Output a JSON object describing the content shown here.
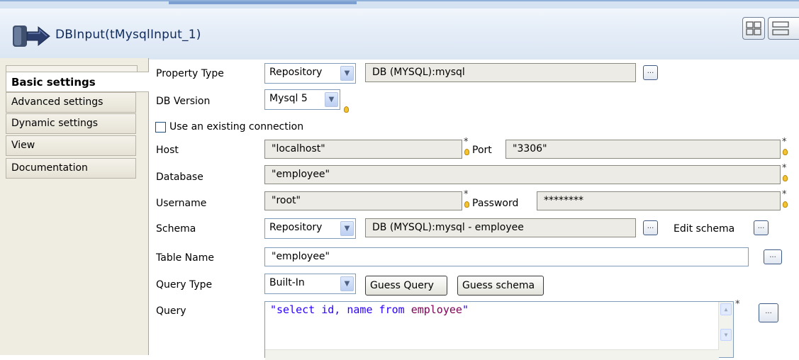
{
  "header": {
    "title": "DBInput(tMysqlInput_1)"
  },
  "icons": {
    "component": "component-arrow-icon",
    "layout_grid": "layout-grid-icon",
    "layout_rows": "layout-rows-icon"
  },
  "nav": {
    "items": [
      {
        "label": "Basic settings",
        "active": true
      },
      {
        "label": "Advanced settings"
      },
      {
        "label": "Dynamic settings"
      },
      {
        "label": "View"
      },
      {
        "label": "Documentation"
      }
    ]
  },
  "form": {
    "property_type": {
      "label": "Property Type",
      "value": "Repository",
      "repo_value": "DB (MYSQL):mysql"
    },
    "db_version": {
      "label": "DB Version",
      "value": "Mysql 5"
    },
    "use_existing_connection": {
      "label": "Use an existing connection",
      "checked": false
    },
    "host": {
      "label": "Host",
      "value": "\"localhost\""
    },
    "port": {
      "label": "Port",
      "value": "\"3306\""
    },
    "database": {
      "label": "Database",
      "value": "\"employee\""
    },
    "username": {
      "label": "Username",
      "value": "\"root\""
    },
    "password": {
      "label": "Password",
      "value": "********"
    },
    "schema": {
      "label": "Schema",
      "value": "Repository",
      "repo_value": "DB (MYSQL):mysql - employee",
      "edit_label": "Edit schema"
    },
    "table_name": {
      "label": "Table Name",
      "value": "\"employee\""
    },
    "query_type": {
      "label": "Query Type",
      "value": "Built-In",
      "guess_query": "Guess Query",
      "guess_schema": "Guess schema"
    },
    "query": {
      "label": "Query",
      "string_part": "\"select id, name from ",
      "keyword": "employee",
      "end_quote": "\""
    },
    "ellipsis": "...",
    "required_mark": "*"
  },
  "colors": {
    "header_title": "#0f2a5a",
    "panel_bg": "#efece2",
    "field_bg": "#ecebe5",
    "query_string": "#2a00ff"
  }
}
